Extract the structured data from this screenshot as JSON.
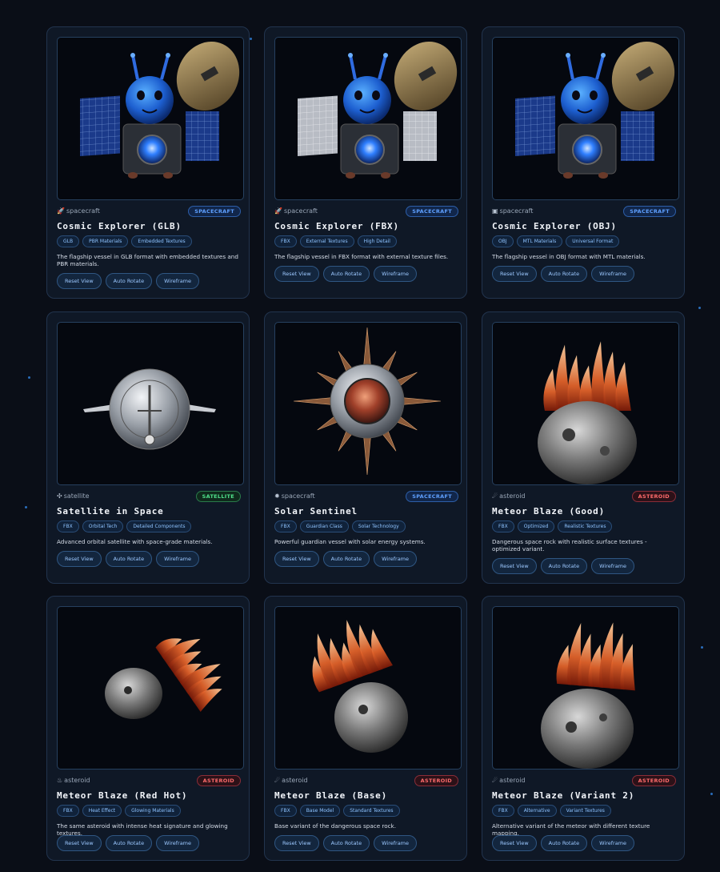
{
  "cards": [
    {
      "type": "spacecraft",
      "type_icon": "rocket-icon",
      "type_glyph": "🚀",
      "badge": "SPACECRAFT",
      "title": "Cosmic Explorer (GLB)",
      "tags": [
        "GLB",
        "PBR Materials",
        "Embedded Textures"
      ],
      "description": "The flagship vessel in GLB format with embedded textures and PBR materials.",
      "model": "explorer"
    },
    {
      "type": "spacecraft",
      "type_icon": "rocket-icon",
      "type_glyph": "🚀",
      "badge": "SPACECRAFT",
      "title": "Cosmic Explorer (FBX)",
      "tags": [
        "FBX",
        "External Textures",
        "High Detail"
      ],
      "description": "The flagship vessel in FBX format with external texture files.",
      "model": "explorer-grey"
    },
    {
      "type": "spacecraft",
      "type_icon": "cube-icon",
      "type_glyph": "▣",
      "badge": "SPACECRAFT",
      "title": "Cosmic Explorer (OBJ)",
      "tags": [
        "OBJ",
        "MTL Materials",
        "Universal Format"
      ],
      "description": "The flagship vessel in OBJ format with MTL materials.",
      "model": "explorer"
    },
    {
      "type": "satellite",
      "type_icon": "satellite-icon",
      "type_glyph": "✣",
      "badge": "SATELLITE",
      "title": "Satellite in Space",
      "tags": [
        "FBX",
        "Orbital Tech",
        "Detailed Components"
      ],
      "description": "Advanced orbital satellite with space-grade materials.",
      "model": "satellite"
    },
    {
      "type": "spacecraft",
      "type_icon": "sun-icon",
      "type_glyph": "✹",
      "badge": "SPACECRAFT",
      "title": "Solar Sentinel",
      "tags": [
        "FBX",
        "Guardian Class",
        "Solar Technology"
      ],
      "description": "Powerful guardian vessel with solar energy systems.",
      "model": "sentinel"
    },
    {
      "type": "asteroid",
      "type_icon": "comet-icon",
      "type_glyph": "☄",
      "badge": "ASTEROID",
      "title": "Meteor Blaze (Good)",
      "tags": [
        "FBX",
        "Optimized",
        "Realistic Textures"
      ],
      "description": "Dangerous space rock with realistic surface textures - optimized variant.",
      "model": "meteor-good"
    },
    {
      "type": "asteroid",
      "type_icon": "fire-icon",
      "type_glyph": "♨",
      "badge": "ASTEROID",
      "title": "Meteor Blaze (Red Hot)",
      "tags": [
        "FBX",
        "Heat Effect",
        "Glowing Materials"
      ],
      "description": "The same asteroid with intense heat signature and glowing textures.",
      "model": "meteor-red"
    },
    {
      "type": "asteroid",
      "type_icon": "comet-icon",
      "type_glyph": "☄",
      "badge": "ASTEROID",
      "title": "Meteor Blaze (Base)",
      "tags": [
        "FBX",
        "Base Model",
        "Standard Textures"
      ],
      "description": "Base variant of the dangerous space rock.",
      "model": "meteor-base"
    },
    {
      "type": "asteroid",
      "type_icon": "comet-icon",
      "type_glyph": "☄",
      "badge": "ASTEROID",
      "title": "Meteor Blaze (Variant 2)",
      "tags": [
        "FBX",
        "Alternative",
        "Variant Textures"
      ],
      "description": "Alternative variant of the meteor with different texture mapping.",
      "model": "meteor-v2"
    }
  ],
  "buttons": {
    "reset": "Reset View",
    "rotate": "Auto Rotate",
    "wireframe": "Wireframe"
  }
}
